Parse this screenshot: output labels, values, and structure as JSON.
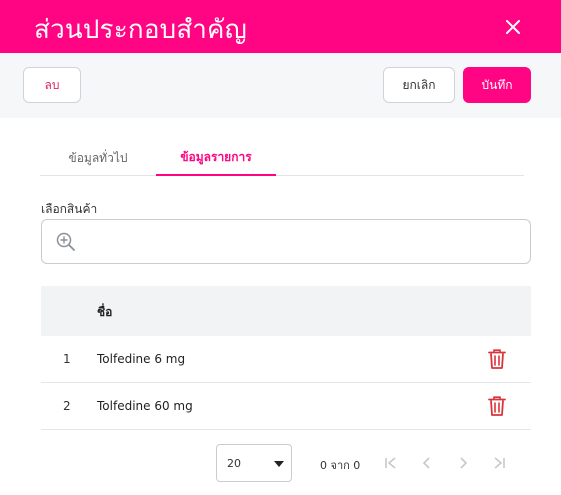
{
  "dialog": {
    "title": "ส่วนประกอบสำคัญ",
    "close_icon": "close-icon"
  },
  "toolbar": {
    "delete_label": "ลบ",
    "cancel_label": "ยกเลิก",
    "save_label": "บันทึก"
  },
  "tabs": [
    {
      "label": "ข้อมูลทั่วไป",
      "active": false
    },
    {
      "label": "ข้อมูลรายการ",
      "active": true
    }
  ],
  "product_search": {
    "label": "เลือกสินค้า",
    "value": "",
    "icon": "zoom-in-icon"
  },
  "table": {
    "columns": [
      "",
      "ชื่อ",
      ""
    ],
    "rows": [
      {
        "no": "1",
        "name": "Tolfedine 6 mg"
      },
      {
        "no": "2",
        "name": "Tolfedine 60 mg"
      }
    ]
  },
  "pagination": {
    "rows_per_page": "20",
    "range_text": "0 จาก 0"
  },
  "colors": {
    "accent": "#ff0583",
    "delete_icon": "#d9343b"
  }
}
